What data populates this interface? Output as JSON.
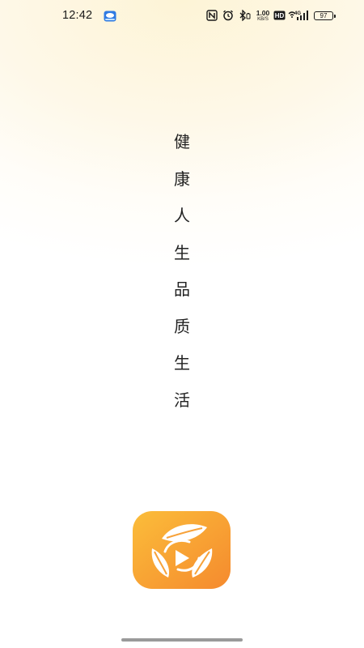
{
  "status_bar": {
    "time": "12:42",
    "net_speed_value": "1.00",
    "net_speed_unit": "KB/S",
    "battery_level": "97",
    "network_label": "4G"
  },
  "splash": {
    "slogan_chars": [
      "健",
      "康",
      "人",
      "生",
      "品",
      "质",
      "生",
      "活"
    ]
  },
  "colors": {
    "logo_gradient_start": "#fbbd3a",
    "logo_gradient_end": "#f58a2e",
    "background_tint": "#fdf4d6"
  },
  "icons": [
    "app-notification-icon",
    "nfc-icon",
    "alarm-icon",
    "bluetooth-icon",
    "hd-icon",
    "wifi-icon",
    "signal-icon",
    "battery-icon",
    "app-logo-icon"
  ]
}
